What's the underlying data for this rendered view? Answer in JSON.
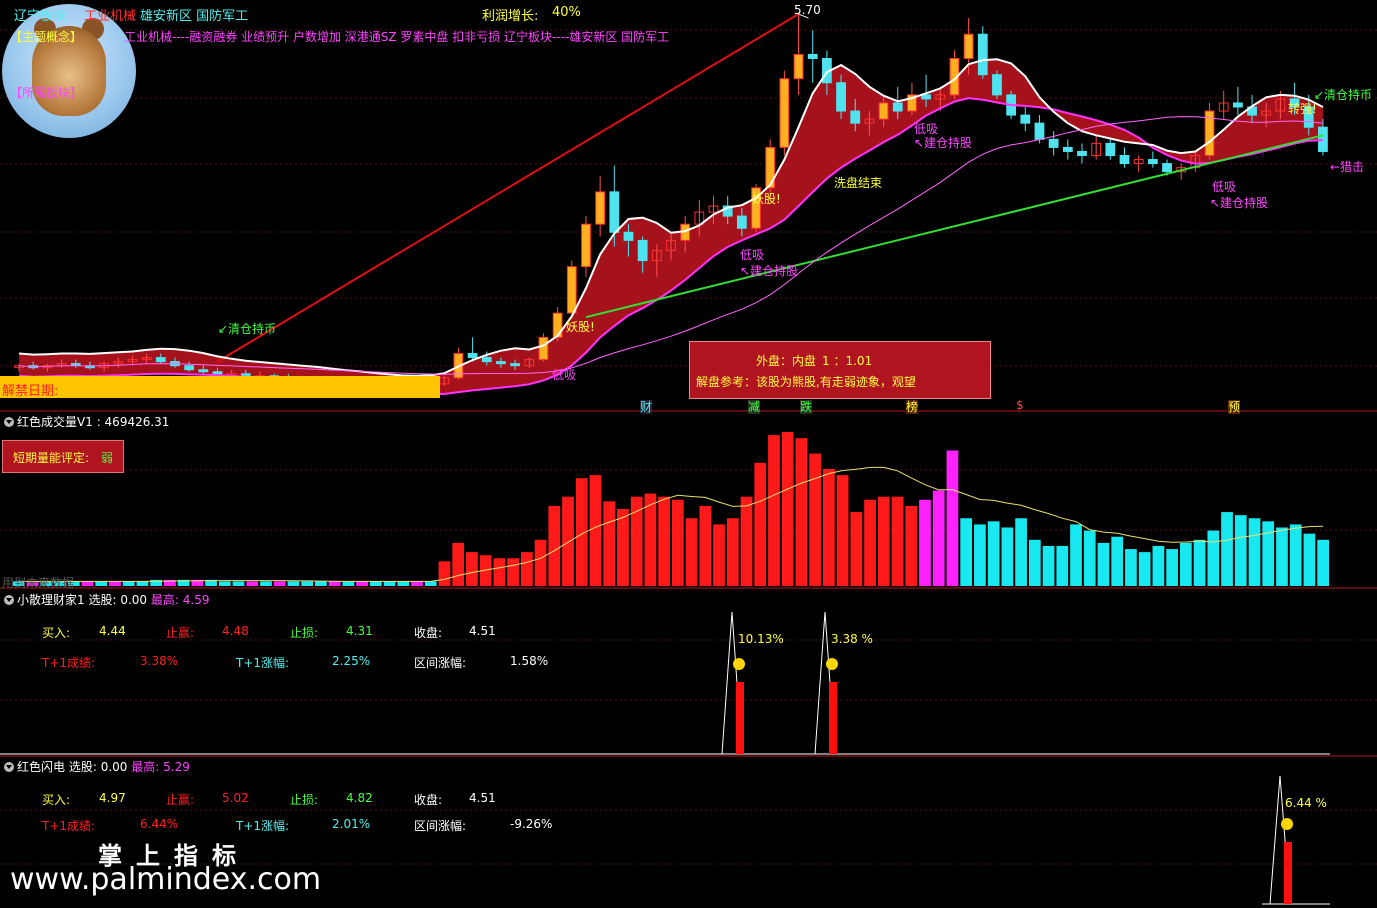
{
  "colors": {
    "up": "#ff2020",
    "down": "#4fe3f0",
    "band_fill": "#b3141e",
    "white_line": "#ffffff",
    "green_line": "#33dd33",
    "magenta_line": "#ff33ff",
    "red_trend": "#e01010",
    "yellow_text": "#ffff40",
    "magenta_text": "#ff44ff",
    "cyan_text": "#55eeee",
    "green_text": "#44ff44",
    "gold_bar": "#ffc400",
    "volume_up": "#ff1a1a",
    "volume_magenta": "#ff22ff",
    "volume_down": "#18e8f0",
    "volume_ma": "#e8e070"
  },
  "header": {
    "sector_main": "辽宁板块",
    "sector_hot": "工业机械",
    "concepts": "雄安新区 国防军工",
    "profit_label": "利润增长:",
    "profit_value": "40%",
    "theme_tag": "【主题概念】",
    "theme_line": "工业机械----融资融券 业绩预升 户数增加 深港通SZ 罗素中盘 扣非亏损 辽宁板块----雄安新区 国防军工",
    "sector_tag": "【所属板块】",
    "logo_icon": "bear-avatar-icon"
  },
  "main_chart": {
    "peak_label": "5.70",
    "lift_date_label": "解禁日期:",
    "events": [
      {
        "label": "财",
        "color": "#55eeee"
      },
      {
        "label": "减",
        "color": "#44ff44"
      },
      {
        "label": "跌",
        "color": "#44ff44"
      },
      {
        "label": "榜",
        "color": "#ffff40"
      },
      {
        "label": "$",
        "color": "#ff4040"
      },
      {
        "label": "预",
        "color": "#ffff40"
      }
    ],
    "annotations": [
      {
        "id": "qc1",
        "text": "↙清仓持币",
        "color": "#44ff44"
      },
      {
        "id": "ys1",
        "text": "妖股!",
        "color": "#ffff40"
      },
      {
        "id": "dx1",
        "text": "低吸",
        "color": "#ff44ff"
      },
      {
        "id": "ys2",
        "text": "妖股!",
        "color": "#ffff40"
      },
      {
        "id": "dx2",
        "text": "低吸",
        "color": "#ff44ff"
      },
      {
        "id": "jc1",
        "text": "↖建仓持股",
        "color": "#ff44ff"
      },
      {
        "id": "xp",
        "text": "洗盘结束",
        "color": "#ffff40"
      },
      {
        "id": "dx3",
        "text": "低吸",
        "color": "#ff44ff"
      },
      {
        "id": "jc2",
        "text": "↖建仓持股",
        "color": "#ff44ff"
      },
      {
        "id": "zq",
        "text": "转强!",
        "color": "#ffff40"
      },
      {
        "id": "qc2",
        "text": "↙清仓持币",
        "color": "#44ff44"
      },
      {
        "id": "zj",
        "text": "←猎击",
        "color": "#ff44ff"
      },
      {
        "id": "dx4",
        "text": "低吸",
        "color": "#ff44ff"
      },
      {
        "id": "jc3",
        "text": "↖建仓持股",
        "color": "#ff44ff"
      }
    ],
    "popup": {
      "line1_label": "外盘：内盘",
      "line1_value": "1 ：1.01",
      "line2": "解盘参考：该股为熊股,有走弱迹象，观望"
    }
  },
  "volume_panel": {
    "title": "红色成交量V1",
    "value": ": 469426.31",
    "rating_label": "短期量能评定:",
    "rating_value": "弱",
    "faint_label": "用到未来数据"
  },
  "panel_a": {
    "name": "小散理财家1",
    "select_label": "选股:",
    "select_value": "0.00",
    "high_label": "最高:",
    "high_value": "4.59",
    "buy_label": "买入:",
    "buy_value": "4.44",
    "tp_label": "止赢:",
    "tp_value": "4.48",
    "sl_label": "止损:",
    "sl_value": "4.31",
    "close_label": "收盘:",
    "close_value": "4.51",
    "t1_label": "T+1成绩:",
    "t1_value": "3.38%",
    "t1c_label": "T+1涨幅:",
    "t1c_value": "2.25%",
    "range_label": "区间涨幅:",
    "range_value": "1.58%",
    "signals": [
      {
        "pct": "10.13%",
        "icon": "smiley-icon"
      },
      {
        "pct": "3.38 %",
        "icon": "smiley-icon"
      }
    ]
  },
  "panel_b": {
    "name": "红色闪电",
    "select_label": "选股:",
    "select_value": "0.00",
    "high_label": "最高:",
    "high_value": "5.29",
    "buy_label": "买入:",
    "buy_value": "4.97",
    "tp_label": "止赢:",
    "tp_value": "5.02",
    "sl_label": "止损:",
    "sl_value": "4.82",
    "close_label": "收盘:",
    "close_value": "4.51",
    "t1_label": "T+1成绩:",
    "t1_value": "6.44%",
    "t1c_label": "T+1涨幅:",
    "t1c_value": "2.01%",
    "range_label": "区间涨幅:",
    "range_value": "-9.26%",
    "signals": [
      {
        "pct": "6.44 %",
        "icon": "smiley-icon"
      }
    ]
  },
  "watermark": {
    "cn": "掌上指标",
    "url": "www.palmindex.com"
  },
  "chart_data": [
    {
      "type": "candlestick",
      "y_peak_label": 5.7,
      "candles": [
        [
          3.95,
          3.97,
          3.93,
          3.96
        ],
        [
          3.96,
          3.98,
          3.94,
          3.95
        ],
        [
          3.95,
          3.97,
          3.93,
          3.96
        ],
        [
          3.96,
          3.99,
          3.95,
          3.97
        ],
        [
          3.97,
          3.99,
          3.95,
          3.96
        ],
        [
          3.96,
          3.98,
          3.94,
          3.95
        ],
        [
          3.95,
          3.98,
          3.93,
          3.97
        ],
        [
          3.97,
          4.0,
          3.95,
          3.98
        ],
        [
          3.98,
          4.01,
          3.96,
          3.99
        ],
        [
          3.99,
          4.02,
          3.97,
          4.0
        ],
        [
          4.0,
          4.02,
          3.97,
          3.98
        ],
        [
          3.98,
          4.0,
          3.95,
          3.96
        ],
        [
          3.96,
          3.98,
          3.93,
          3.94
        ],
        [
          3.94,
          3.96,
          3.92,
          3.93
        ],
        [
          3.93,
          3.95,
          3.91,
          3.92
        ],
        [
          3.92,
          3.94,
          3.9,
          3.92
        ],
        [
          3.92,
          3.94,
          3.9,
          3.91
        ],
        [
          3.91,
          3.93,
          3.89,
          3.91
        ],
        [
          3.91,
          3.92,
          3.88,
          3.9
        ],
        [
          3.9,
          3.92,
          3.88,
          3.89
        ],
        [
          3.89,
          3.91,
          3.87,
          3.89
        ],
        [
          3.89,
          3.9,
          3.86,
          3.88
        ],
        [
          3.88,
          3.9,
          3.86,
          3.87
        ],
        [
          3.87,
          3.89,
          3.85,
          3.86
        ],
        [
          3.86,
          3.88,
          3.84,
          3.86
        ],
        [
          3.86,
          3.88,
          3.84,
          3.85
        ],
        [
          3.85,
          3.87,
          3.83,
          3.85
        ],
        [
          3.85,
          3.87,
          3.83,
          3.84
        ],
        [
          3.84,
          3.86,
          3.83,
          3.85
        ],
        [
          3.85,
          3.88,
          3.84,
          3.87
        ],
        [
          3.87,
          3.91,
          3.86,
          3.9
        ],
        [
          3.9,
          4.05,
          3.89,
          4.02
        ],
        [
          4.02,
          4.1,
          3.98,
          4.0
        ],
        [
          4.0,
          4.03,
          3.96,
          3.98
        ],
        [
          3.98,
          4.0,
          3.95,
          3.97
        ],
        [
          3.97,
          3.99,
          3.94,
          3.96
        ],
        [
          3.96,
          4.0,
          3.95,
          3.99
        ],
        [
          3.99,
          4.12,
          3.98,
          4.1
        ],
        [
          4.1,
          4.25,
          4.08,
          4.22
        ],
        [
          4.22,
          4.48,
          4.2,
          4.45
        ],
        [
          4.45,
          4.7,
          4.4,
          4.66
        ],
        [
          4.66,
          4.9,
          4.6,
          4.82
        ],
        [
          4.82,
          4.95,
          4.55,
          4.62
        ],
        [
          4.62,
          4.66,
          4.5,
          4.58
        ],
        [
          4.58,
          4.6,
          4.42,
          4.48
        ],
        [
          4.48,
          4.56,
          4.4,
          4.53
        ],
        [
          4.53,
          4.62,
          4.48,
          4.58
        ],
        [
          4.58,
          4.7,
          4.52,
          4.66
        ],
        [
          4.66,
          4.78,
          4.6,
          4.72
        ],
        [
          4.72,
          4.8,
          4.66,
          4.75
        ],
        [
          4.75,
          4.8,
          4.66,
          4.7
        ],
        [
          4.7,
          4.74,
          4.6,
          4.64
        ],
        [
          4.64,
          4.86,
          4.62,
          4.84
        ],
        [
          4.84,
          5.08,
          4.8,
          5.04
        ],
        [
          5.04,
          5.42,
          5.0,
          5.38
        ],
        [
          5.38,
          5.7,
          5.3,
          5.5
        ],
        [
          5.5,
          5.62,
          5.36,
          5.48
        ],
        [
          5.48,
          5.52,
          5.3,
          5.36
        ],
        [
          5.36,
          5.4,
          5.18,
          5.22
        ],
        [
          5.22,
          5.28,
          5.12,
          5.16
        ],
        [
          5.16,
          5.22,
          5.1,
          5.18
        ],
        [
          5.18,
          5.3,
          5.14,
          5.26
        ],
        [
          5.26,
          5.34,
          5.18,
          5.22
        ],
        [
          5.22,
          5.36,
          5.2,
          5.3
        ],
        [
          5.3,
          5.4,
          5.24,
          5.28
        ],
        [
          5.28,
          5.34,
          5.22,
          5.3
        ],
        [
          5.3,
          5.52,
          5.28,
          5.48
        ],
        [
          5.48,
          5.68,
          5.4,
          5.6
        ],
        [
          5.6,
          5.64,
          5.38,
          5.4
        ],
        [
          5.4,
          5.42,
          5.28,
          5.3
        ],
        [
          5.3,
          5.32,
          5.18,
          5.2
        ],
        [
          5.2,
          5.24,
          5.12,
          5.16
        ],
        [
          5.16,
          5.2,
          5.06,
          5.08
        ],
        [
          5.08,
          5.12,
          5.0,
          5.04
        ],
        [
          5.04,
          5.08,
          4.98,
          5.02
        ],
        [
          5.02,
          5.06,
          4.96,
          5.0
        ],
        [
          5.0,
          5.1,
          4.98,
          5.06
        ],
        [
          5.06,
          5.08,
          4.98,
          5.0
        ],
        [
          5.0,
          5.04,
          4.94,
          4.96
        ],
        [
          4.96,
          5.0,
          4.92,
          4.98
        ],
        [
          4.98,
          5.02,
          4.94,
          4.96
        ],
        [
          4.96,
          4.98,
          4.9,
          4.92
        ],
        [
          4.92,
          4.96,
          4.88,
          4.94
        ],
        [
          4.94,
          5.02,
          4.92,
          5.0
        ],
        [
          5.0,
          5.26,
          4.98,
          5.22
        ],
        [
          5.22,
          5.32,
          5.18,
          5.26
        ],
        [
          5.26,
          5.34,
          5.2,
          5.24
        ],
        [
          5.24,
          5.3,
          5.16,
          5.2
        ],
        [
          5.2,
          5.26,
          5.14,
          5.22
        ],
        [
          5.22,
          5.32,
          5.18,
          5.28
        ],
        [
          5.28,
          5.36,
          5.2,
          5.24
        ],
        [
          5.24,
          5.3,
          5.1,
          5.14
        ],
        [
          5.14,
          5.18,
          5.0,
          5.02
        ]
      ]
    },
    {
      "type": "bar",
      "title": "红色成交量V1",
      "values": [
        3,
        3,
        3,
        3,
        3,
        3,
        3,
        3,
        3,
        3,
        4,
        4,
        4,
        4,
        4,
        3,
        3,
        3,
        3,
        3,
        3,
        3,
        3,
        3,
        3,
        3,
        3,
        3,
        3,
        3,
        3,
        16,
        28,
        22,
        20,
        18,
        18,
        22,
        30,
        52,
        58,
        70,
        72,
        55,
        50,
        58,
        60,
        58,
        56,
        44,
        52,
        40,
        44,
        58,
        80,
        98,
        100,
        96,
        86,
        76,
        72,
        48,
        56,
        58,
        58,
        52,
        56,
        62,
        88,
        44,
        40,
        42,
        38,
        44,
        30,
        26,
        26,
        40,
        36,
        28,
        32,
        24,
        22,
        26,
        24,
        28,
        30,
        36,
        48,
        46,
        44,
        42,
        38,
        40,
        34,
        30
      ],
      "ma_line": "on"
    },
    {
      "type": "line",
      "name": "小散理财家1",
      "signals": [
        {
          "pct": 10.13
        },
        {
          "pct": 3.38
        }
      ]
    },
    {
      "type": "line",
      "name": "红色闪电",
      "signals": [
        {
          "pct": 6.44
        }
      ]
    }
  ]
}
